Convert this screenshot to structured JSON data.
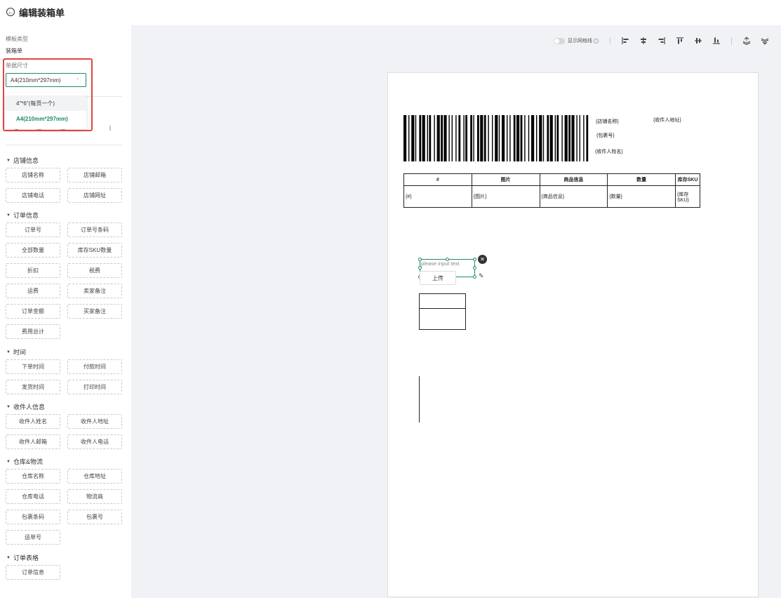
{
  "header": {
    "back_icon": "arrow-left-icon",
    "title": "编辑装箱单"
  },
  "sidebar": {
    "template_type_label": "模板类型",
    "template_type_value": "装箱单",
    "paper_size_label": "单据尺寸",
    "paper_size_value": "A4(210mm*297mm)",
    "paper_size_options": [
      "4\"*6\"(每页一个)",
      "A4(210mm*297mm)"
    ],
    "groups": [
      {
        "title": "店铺信息",
        "items": [
          "店铺名称",
          "店铺邮箱",
          "店铺电话",
          "店铺网址"
        ]
      },
      {
        "title": "订单信息",
        "items": [
          "订单号",
          "订单号条码",
          "全部数量",
          "库存SKU数量",
          "折扣",
          "税费",
          "运费",
          "卖家备注",
          "订单金额",
          "买家备注",
          "费用总计"
        ]
      },
      {
        "title": "时间",
        "items": [
          "下单时间",
          "付款时间",
          "发货时间",
          "打印时间"
        ]
      },
      {
        "title": "收件人信息",
        "items": [
          "收件人姓名",
          "收件人地址",
          "收件人邮箱",
          "收件人电话"
        ]
      },
      {
        "title": "仓库&物流",
        "items": [
          "仓库名称",
          "仓库地址",
          "仓库电话",
          "物流商",
          "包裹条码",
          "包裹号",
          "运单号"
        ]
      },
      {
        "title": "订单表格",
        "items": [
          "订单信息"
        ]
      }
    ]
  },
  "toolbar": {
    "grid_toggle_label": "显示网格线",
    "grid_on": false,
    "icons": [
      "align-left-icon",
      "align-center-h-icon",
      "align-right-icon",
      "align-top-icon",
      "align-middle-v-icon",
      "align-bottom-icon",
      "layer-up-icon",
      "layer-down-icon"
    ]
  },
  "paper": {
    "placeholders": {
      "shop_name": "{店铺名称}",
      "receiver_address": "{收件人地址}",
      "package_no": "{包裹号}",
      "receiver_name": "{收件人姓名}"
    },
    "table": {
      "headers": [
        "#",
        "图片",
        "商品信息",
        "数量",
        "库存SKU"
      ],
      "row": [
        "{#}",
        "{图片}",
        "{商品信息}",
        "{数量}",
        "{库存SKU}"
      ]
    },
    "text_placeholder": "please input text",
    "upload_label": "上传"
  }
}
